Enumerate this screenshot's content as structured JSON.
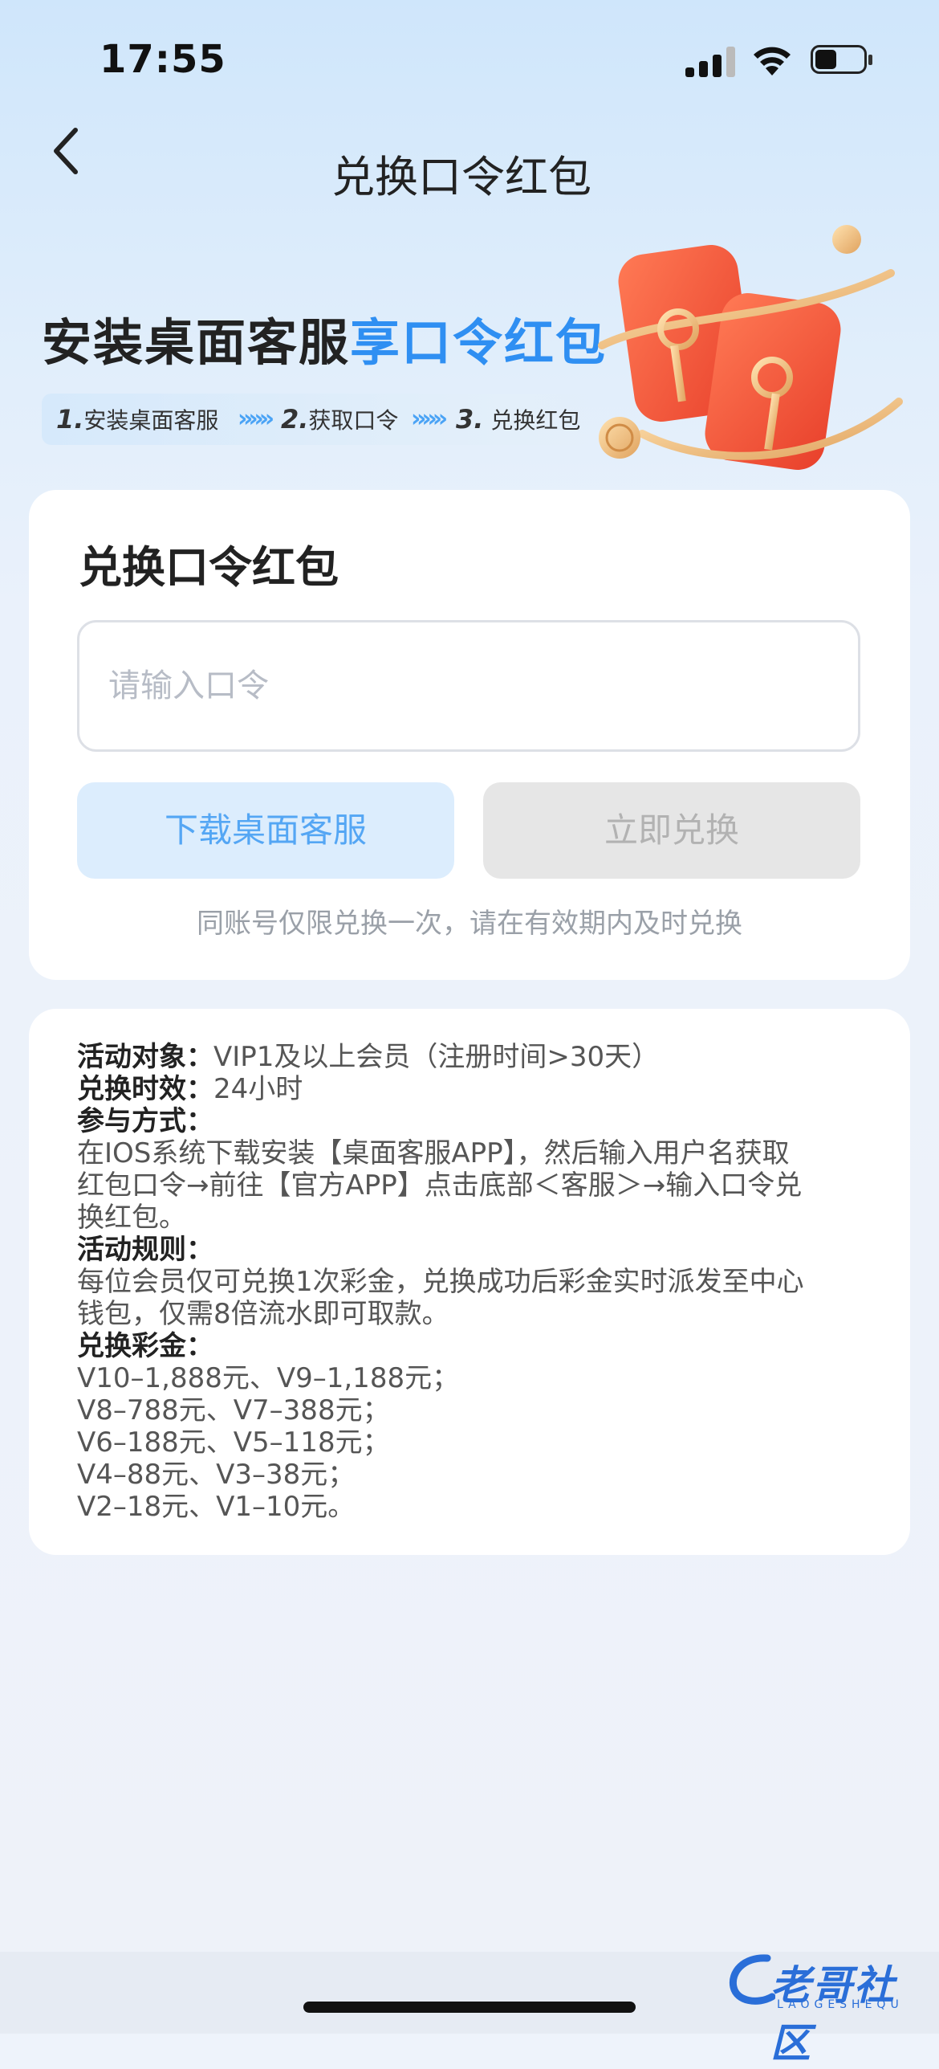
{
  "status_bar": {
    "time": "17:55"
  },
  "nav": {
    "title": "兑换口令红包"
  },
  "banner": {
    "title_main": "安装桌面客服",
    "title_highlight": "享口令红包",
    "steps": [
      {
        "num": "1.",
        "label": "安装桌面客服"
      },
      {
        "num": "2.",
        "label": "获取口令"
      },
      {
        "num": "3.",
        "label": "兑换红包"
      }
    ],
    "chevrons": "»»»"
  },
  "redeem_card": {
    "title": "兑换口令红包",
    "input_placeholder": "请输入口令",
    "download_label": "下载桌面客服",
    "redeem_label": "立即兑换",
    "note": "同账号仅限兑换一次，请在有效期内及时兑换"
  },
  "rules": {
    "target_label": "活动对象：",
    "target_value": "VIP1及以上会员（注册时间>30天）",
    "validity_label": "兑换时效：",
    "validity_value": "24小时",
    "method_label": "参与方式：",
    "method_lines": [
      "在IOS系统下载安装【桌面客服APP】，然后输入用户名获取",
      "红包口令→前往【官方APP】点击底部＜客服＞→输入口令兑",
      "换红包。"
    ],
    "rules_label": "活动规则：",
    "rules_lines": [
      "每位会员仅可兑换1次彩金，兑换成功后彩金实时派发至中心",
      "钱包，仅需8倍流水即可取款。"
    ],
    "bonus_label": "兑换彩金：",
    "bonus_lines": [
      "V10–1,888元、V9–1,188元；",
      "V8–788元、V7–388元；",
      "V6–188元、V5–118元；",
      "V4–88元、V3–38元；",
      "V2–18元、V1–10元。"
    ]
  },
  "watermark": {
    "text": "老哥社区",
    "sub": "LAOGESHEQU"
  }
}
